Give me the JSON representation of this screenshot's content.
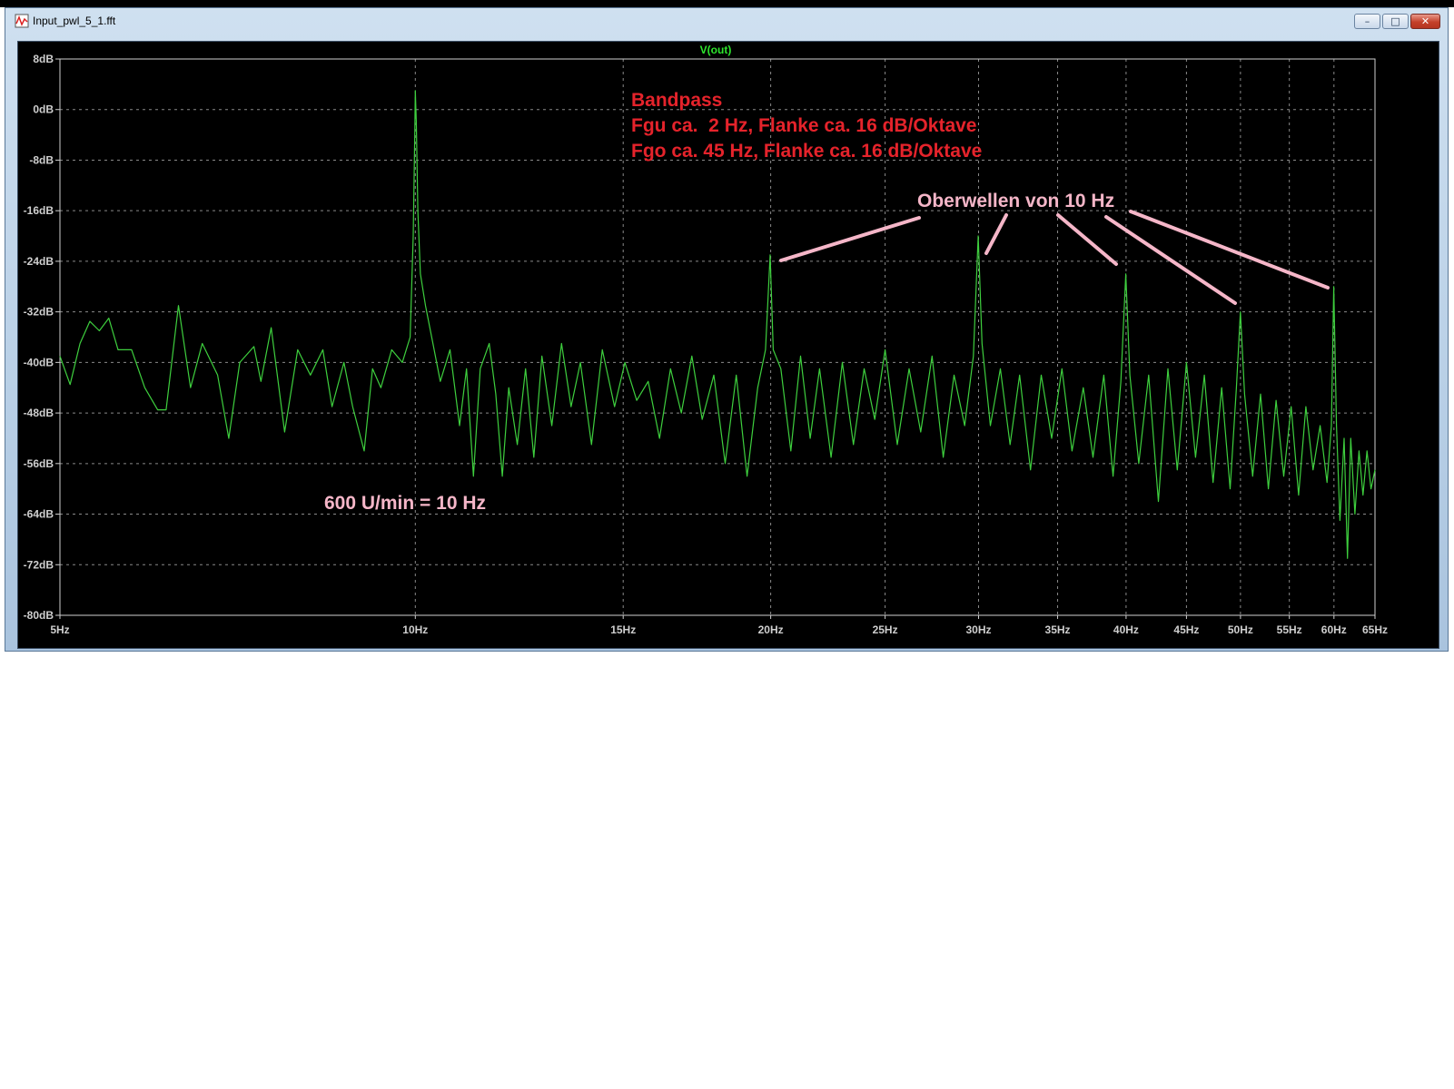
{
  "window": {
    "title": "Input_pwl_5_1.fft",
    "buttons": {
      "minimize": "–",
      "maximize": "□",
      "close": "✕"
    }
  },
  "chart_data": {
    "type": "line",
    "title": "V(out)",
    "xlabel": "",
    "ylabel": "",
    "x_scale": "log",
    "xlim": [
      5,
      65
    ],
    "ylim": [
      -80,
      8
    ],
    "grid": true,
    "colors": {
      "trace": "#3ecf3e",
      "grid": "#8a8a8a",
      "axis": "#cfcfcf",
      "title": "#2ee62e",
      "annotation_red": "#e5232b",
      "annotation_pink": "#f5b6c8"
    },
    "x_ticks": [
      {
        "value": 5,
        "label": "5Hz"
      },
      {
        "value": 10,
        "label": "10Hz"
      },
      {
        "value": 15,
        "label": "15Hz"
      },
      {
        "value": 20,
        "label": "20Hz"
      },
      {
        "value": 25,
        "label": "25Hz"
      },
      {
        "value": 30,
        "label": "30Hz"
      },
      {
        "value": 35,
        "label": "35Hz"
      },
      {
        "value": 40,
        "label": "40Hz"
      },
      {
        "value": 45,
        "label": "45Hz"
      },
      {
        "value": 50,
        "label": "50Hz"
      },
      {
        "value": 55,
        "label": "55Hz"
      },
      {
        "value": 60,
        "label": "60Hz"
      },
      {
        "value": 65,
        "label": "65Hz"
      }
    ],
    "y_ticks": [
      {
        "value": 8,
        "label": "8dB"
      },
      {
        "value": 0,
        "label": "0dB"
      },
      {
        "value": -8,
        "label": "-8dB"
      },
      {
        "value": -16,
        "label": "-16dB"
      },
      {
        "value": -24,
        "label": "-24dB"
      },
      {
        "value": -32,
        "label": "-32dB"
      },
      {
        "value": -40,
        "label": "-40dB"
      },
      {
        "value": -48,
        "label": "-48dB"
      },
      {
        "value": -56,
        "label": "-56dB"
      },
      {
        "value": -64,
        "label": "-64dB"
      },
      {
        "value": -72,
        "label": "-72dB"
      },
      {
        "value": -80,
        "label": "-80dB"
      }
    ],
    "series": [
      {
        "name": "V(out)",
        "points": [
          [
            5.0,
            -39
          ],
          [
            5.1,
            -43.5
          ],
          [
            5.2,
            -37
          ],
          [
            5.3,
            -33.5
          ],
          [
            5.4,
            -35
          ],
          [
            5.5,
            -33
          ],
          [
            5.6,
            -38
          ],
          [
            5.75,
            -38
          ],
          [
            5.9,
            -44
          ],
          [
            6.05,
            -47.5
          ],
          [
            6.15,
            -47.5
          ],
          [
            6.3,
            -31
          ],
          [
            6.45,
            -44
          ],
          [
            6.6,
            -37
          ],
          [
            6.8,
            -42
          ],
          [
            6.95,
            -52
          ],
          [
            7.1,
            -40
          ],
          [
            7.3,
            -37.5
          ],
          [
            7.4,
            -43
          ],
          [
            7.55,
            -34.5
          ],
          [
            7.75,
            -51
          ],
          [
            7.95,
            -38
          ],
          [
            8.15,
            -42
          ],
          [
            8.35,
            -38
          ],
          [
            8.5,
            -47
          ],
          [
            8.7,
            -40
          ],
          [
            8.85,
            -47
          ],
          [
            9.05,
            -54
          ],
          [
            9.2,
            -41
          ],
          [
            9.35,
            -44
          ],
          [
            9.55,
            -38
          ],
          [
            9.75,
            -40
          ],
          [
            9.9,
            -36
          ],
          [
            9.96,
            -20
          ],
          [
            9.99,
            -4
          ],
          [
            10.0,
            3
          ],
          [
            10.02,
            -2
          ],
          [
            10.05,
            -16
          ],
          [
            10.1,
            -26
          ],
          [
            10.2,
            -31
          ],
          [
            10.35,
            -37
          ],
          [
            10.5,
            -43
          ],
          [
            10.7,
            -38
          ],
          [
            10.9,
            -50
          ],
          [
            11.05,
            -41
          ],
          [
            11.2,
            -58
          ],
          [
            11.35,
            -41
          ],
          [
            11.55,
            -37
          ],
          [
            11.7,
            -45
          ],
          [
            11.85,
            -58
          ],
          [
            12.0,
            -44
          ],
          [
            12.2,
            -53
          ],
          [
            12.4,
            -41
          ],
          [
            12.6,
            -55
          ],
          [
            12.8,
            -39
          ],
          [
            13.05,
            -50
          ],
          [
            13.3,
            -37
          ],
          [
            13.55,
            -47
          ],
          [
            13.8,
            -40
          ],
          [
            14.1,
            -53
          ],
          [
            14.4,
            -38
          ],
          [
            14.75,
            -47
          ],
          [
            15.05,
            -40
          ],
          [
            15.4,
            -46
          ],
          [
            15.75,
            -43
          ],
          [
            16.1,
            -52
          ],
          [
            16.45,
            -41
          ],
          [
            16.8,
            -48
          ],
          [
            17.15,
            -39
          ],
          [
            17.5,
            -49
          ],
          [
            17.9,
            -42
          ],
          [
            18.3,
            -56
          ],
          [
            18.7,
            -42
          ],
          [
            19.1,
            -58
          ],
          [
            19.5,
            -44
          ],
          [
            19.8,
            -38
          ],
          [
            19.98,
            -23
          ],
          [
            20.1,
            -38
          ],
          [
            20.4,
            -41
          ],
          [
            20.8,
            -54
          ],
          [
            21.2,
            -39
          ],
          [
            21.6,
            -52
          ],
          [
            22.0,
            -41
          ],
          [
            22.5,
            -55
          ],
          [
            23.0,
            -40
          ],
          [
            23.5,
            -53
          ],
          [
            24.0,
            -41
          ],
          [
            24.5,
            -49
          ],
          [
            25.0,
            -38
          ],
          [
            25.6,
            -53
          ],
          [
            26.2,
            -41
          ],
          [
            26.8,
            -51
          ],
          [
            27.4,
            -39
          ],
          [
            28.0,
            -55
          ],
          [
            28.6,
            -42
          ],
          [
            29.2,
            -50
          ],
          [
            29.7,
            -39
          ],
          [
            29.98,
            -20
          ],
          [
            30.2,
            -37
          ],
          [
            30.7,
            -50
          ],
          [
            31.3,
            -41
          ],
          [
            31.9,
            -53
          ],
          [
            32.5,
            -42
          ],
          [
            33.2,
            -57
          ],
          [
            33.9,
            -42
          ],
          [
            34.6,
            -52
          ],
          [
            35.3,
            -41
          ],
          [
            36.0,
            -54
          ],
          [
            36.8,
            -44
          ],
          [
            37.5,
            -55
          ],
          [
            38.3,
            -42
          ],
          [
            39.0,
            -58
          ],
          [
            39.6,
            -43
          ],
          [
            39.98,
            -26
          ],
          [
            40.3,
            -42
          ],
          [
            41.0,
            -56
          ],
          [
            41.8,
            -42
          ],
          [
            42.6,
            -62
          ],
          [
            43.4,
            -41
          ],
          [
            44.2,
            -57
          ],
          [
            45.0,
            -40
          ],
          [
            45.8,
            -55
          ],
          [
            46.6,
            -42
          ],
          [
            47.4,
            -59
          ],
          [
            48.2,
            -44
          ],
          [
            49.0,
            -60
          ],
          [
            49.6,
            -44
          ],
          [
            49.99,
            -32
          ],
          [
            50.4,
            -45
          ],
          [
            51.2,
            -58
          ],
          [
            52.0,
            -45
          ],
          [
            52.8,
            -60
          ],
          [
            53.6,
            -46
          ],
          [
            54.4,
            -58
          ],
          [
            55.2,
            -47
          ],
          [
            56.0,
            -61
          ],
          [
            56.8,
            -47
          ],
          [
            57.6,
            -57
          ],
          [
            58.4,
            -50
          ],
          [
            59.2,
            -59
          ],
          [
            59.7,
            -50
          ],
          [
            59.98,
            -28
          ],
          [
            60.3,
            -50
          ],
          [
            60.7,
            -65
          ],
          [
            61.2,
            -52
          ],
          [
            61.6,
            -71
          ],
          [
            62.0,
            -52
          ],
          [
            62.5,
            -64
          ],
          [
            63.0,
            -54
          ],
          [
            63.5,
            -61
          ],
          [
            64.0,
            -54
          ],
          [
            64.5,
            -60
          ],
          [
            65.0,
            -57
          ]
        ]
      }
    ],
    "annotations": {
      "bandpass_title": "Bandpass",
      "fgu_line": "Fgu ca.  2 Hz, Flanke ca. 16 dB/Oktave",
      "fgo_line": "Fgo ca. 45 Hz, Flanke ca. 16 dB/Oktave",
      "harmonics_label": "Oberwellen von 10 Hz",
      "fundamental_label": "600 U/min = 10 Hz"
    }
  }
}
